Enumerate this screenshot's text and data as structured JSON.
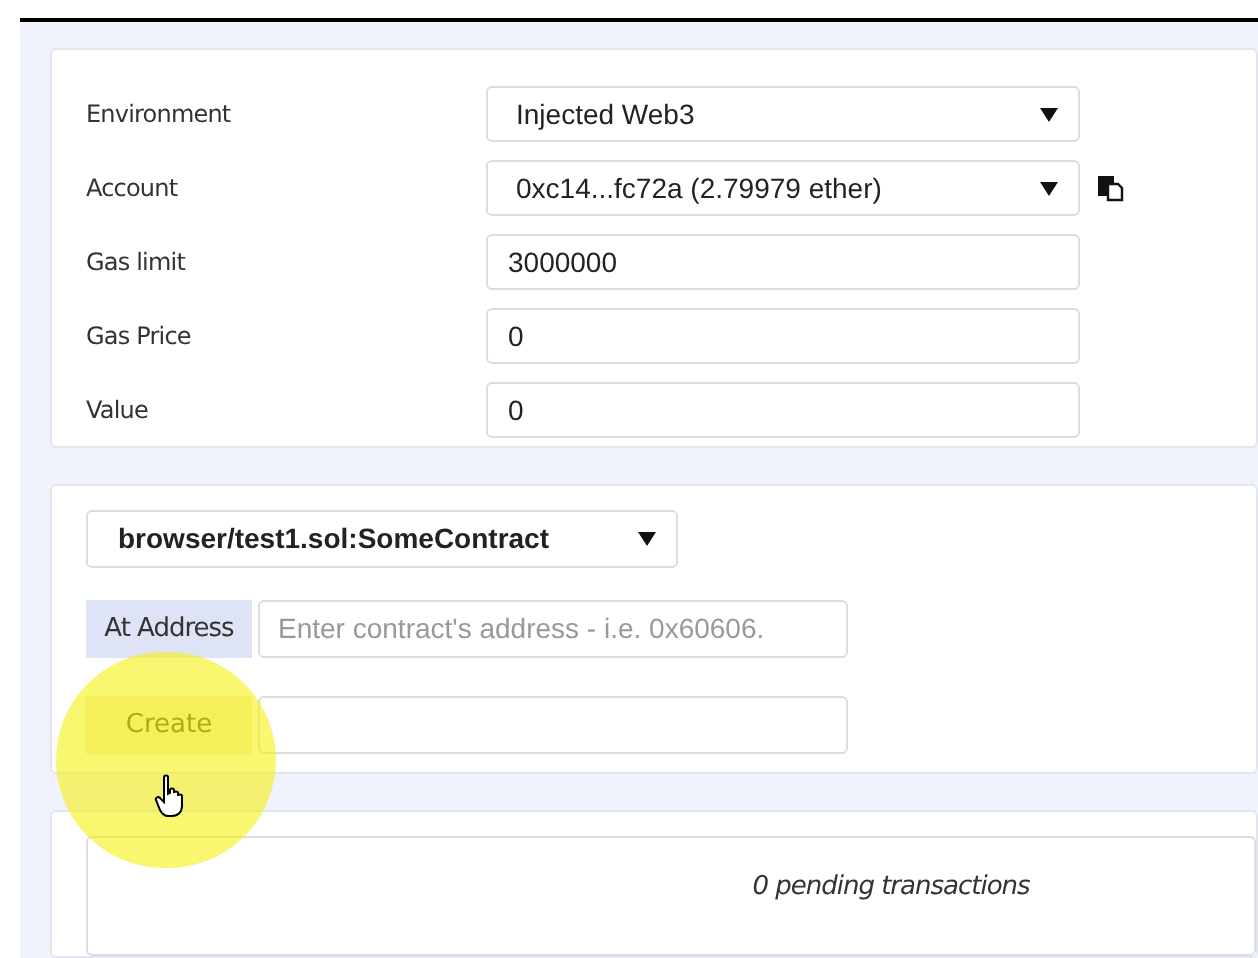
{
  "settings": [
    {
      "label": "Environment",
      "kind": "select",
      "value": "Injected Web3"
    },
    {
      "label": "Account",
      "kind": "select",
      "value": "0xc14...fc72a (2.79979 ether)",
      "copy": true
    },
    {
      "label": "Gas limit",
      "kind": "input",
      "value": "3000000"
    },
    {
      "label": "Gas Price",
      "kind": "input",
      "value": "0"
    },
    {
      "label": "Value",
      "kind": "input",
      "value": "0"
    }
  ],
  "contract": {
    "selected": "browser/test1.sol:SomeContract"
  },
  "at_address": {
    "label": "At Address",
    "placeholder": "Enter contract's address - i.e. 0x60606."
  },
  "create": {
    "label": "Create"
  },
  "pending": "0 pending transactions"
}
